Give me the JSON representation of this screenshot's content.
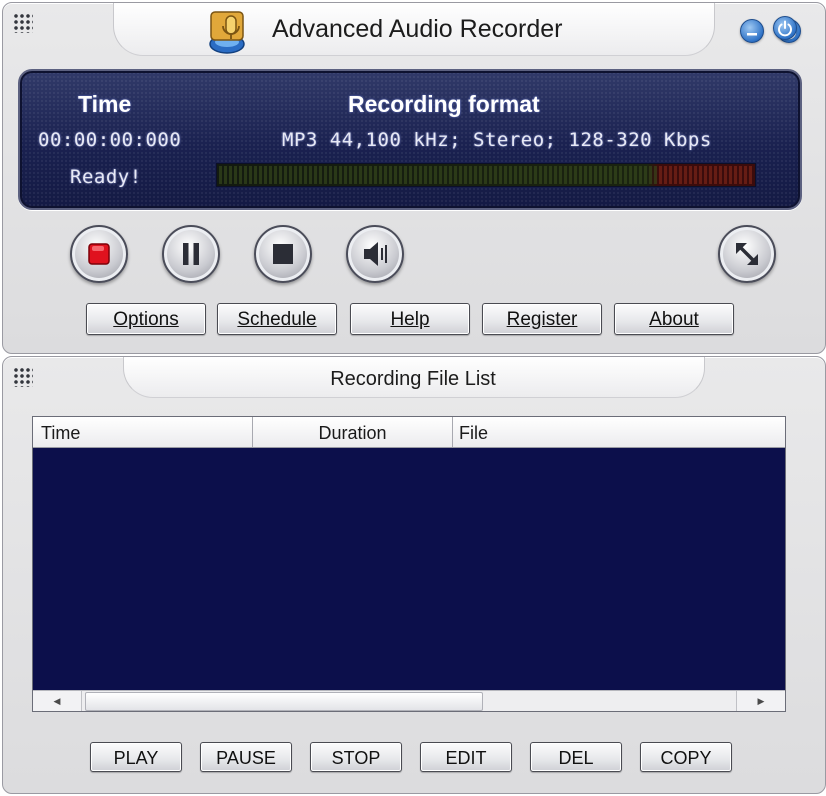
{
  "app": {
    "title": "Advanced Audio Recorder",
    "icons": {
      "logo": "microphone-logo-icon",
      "minimize": "minimize-icon",
      "power": "power-icon"
    }
  },
  "display": {
    "time_label": "Time",
    "format_label": "Recording format",
    "time_value": "00:00:00:000",
    "format_value": "MP3 44,100 kHz; Stereo; 128-320 Kbps",
    "status": "Ready!",
    "level": 0
  },
  "transport": {
    "record_icon": "record-icon",
    "pause_icon": "pause-icon",
    "stop_icon": "stop-icon",
    "volume_icon": "volume-icon",
    "expand_icon": "expand-icon"
  },
  "menu": {
    "options": "Options",
    "schedule": "Schedule",
    "help": "Help",
    "register": "Register",
    "about": "About"
  },
  "file_list": {
    "title": "Recording File List",
    "columns": [
      "Time",
      "Duration",
      "File"
    ],
    "rows": []
  },
  "actions": {
    "play": "PLAY",
    "pause": "PAUSE",
    "stop": "STOP",
    "edit": "EDIT",
    "del": "DEL",
    "copy": "COPY"
  },
  "colors": {
    "display_bg": "#1a2150",
    "list_bg": "#0c0f4b",
    "accent_blue": "#2f73c7",
    "record_red": "#e0121e"
  }
}
